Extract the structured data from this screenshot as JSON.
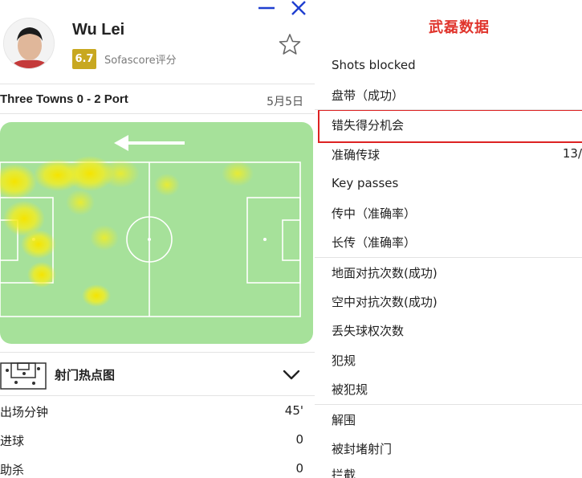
{
  "header": {
    "player_name": "Wu Lei",
    "rating": "6.7",
    "rating_source": "Sofascore评分"
  },
  "match": {
    "title": "Three Towns 0 - 2 Port",
    "date": "5月5日"
  },
  "heatmap_section": {
    "label": "射门热点图"
  },
  "stats_left": [
    {
      "label": "出场分钟",
      "value": "45'"
    },
    {
      "label": "进球",
      "value": "0"
    },
    {
      "label": "助杀",
      "value": "0"
    }
  ],
  "right_panel": {
    "title": "武磊数据",
    "items": [
      {
        "label": "Shots blocked",
        "value": ""
      },
      {
        "label": "盘带（成功）",
        "value": ""
      },
      {
        "label": "错失得分机会",
        "value": ""
      },
      {
        "label": "准确传球",
        "value": "13/"
      },
      {
        "label": "Key passes",
        "value": ""
      },
      {
        "label": "传中（准确率）",
        "value": ""
      },
      {
        "label": "长传（准确率）",
        "value": ""
      },
      {
        "label": "地面对抗次数(成功)",
        "value": ""
      },
      {
        "label": "空中对抗次数(成功)",
        "value": ""
      },
      {
        "label": "丢失球权次数",
        "value": ""
      },
      {
        "label": "犯规",
        "value": ""
      },
      {
        "label": "被犯规",
        "value": ""
      },
      {
        "label": "解围",
        "value": ""
      },
      {
        "label": "被封堵射门",
        "value": ""
      },
      {
        "label": "拦截",
        "value": ""
      }
    ]
  },
  "colors": {
    "pitch_green": "#a6e19a",
    "heat_yellow": "#f7ee1c",
    "rating_badge": "#c8a820",
    "accent_blue": "#1f3fd0",
    "title_red": "#e0342c",
    "highlight_red": "#dd2222"
  },
  "icons": [
    "close-icon",
    "minimize-icon",
    "star-icon",
    "chevron-down-icon",
    "goal-area-icon",
    "arrow-left-icon"
  ]
}
